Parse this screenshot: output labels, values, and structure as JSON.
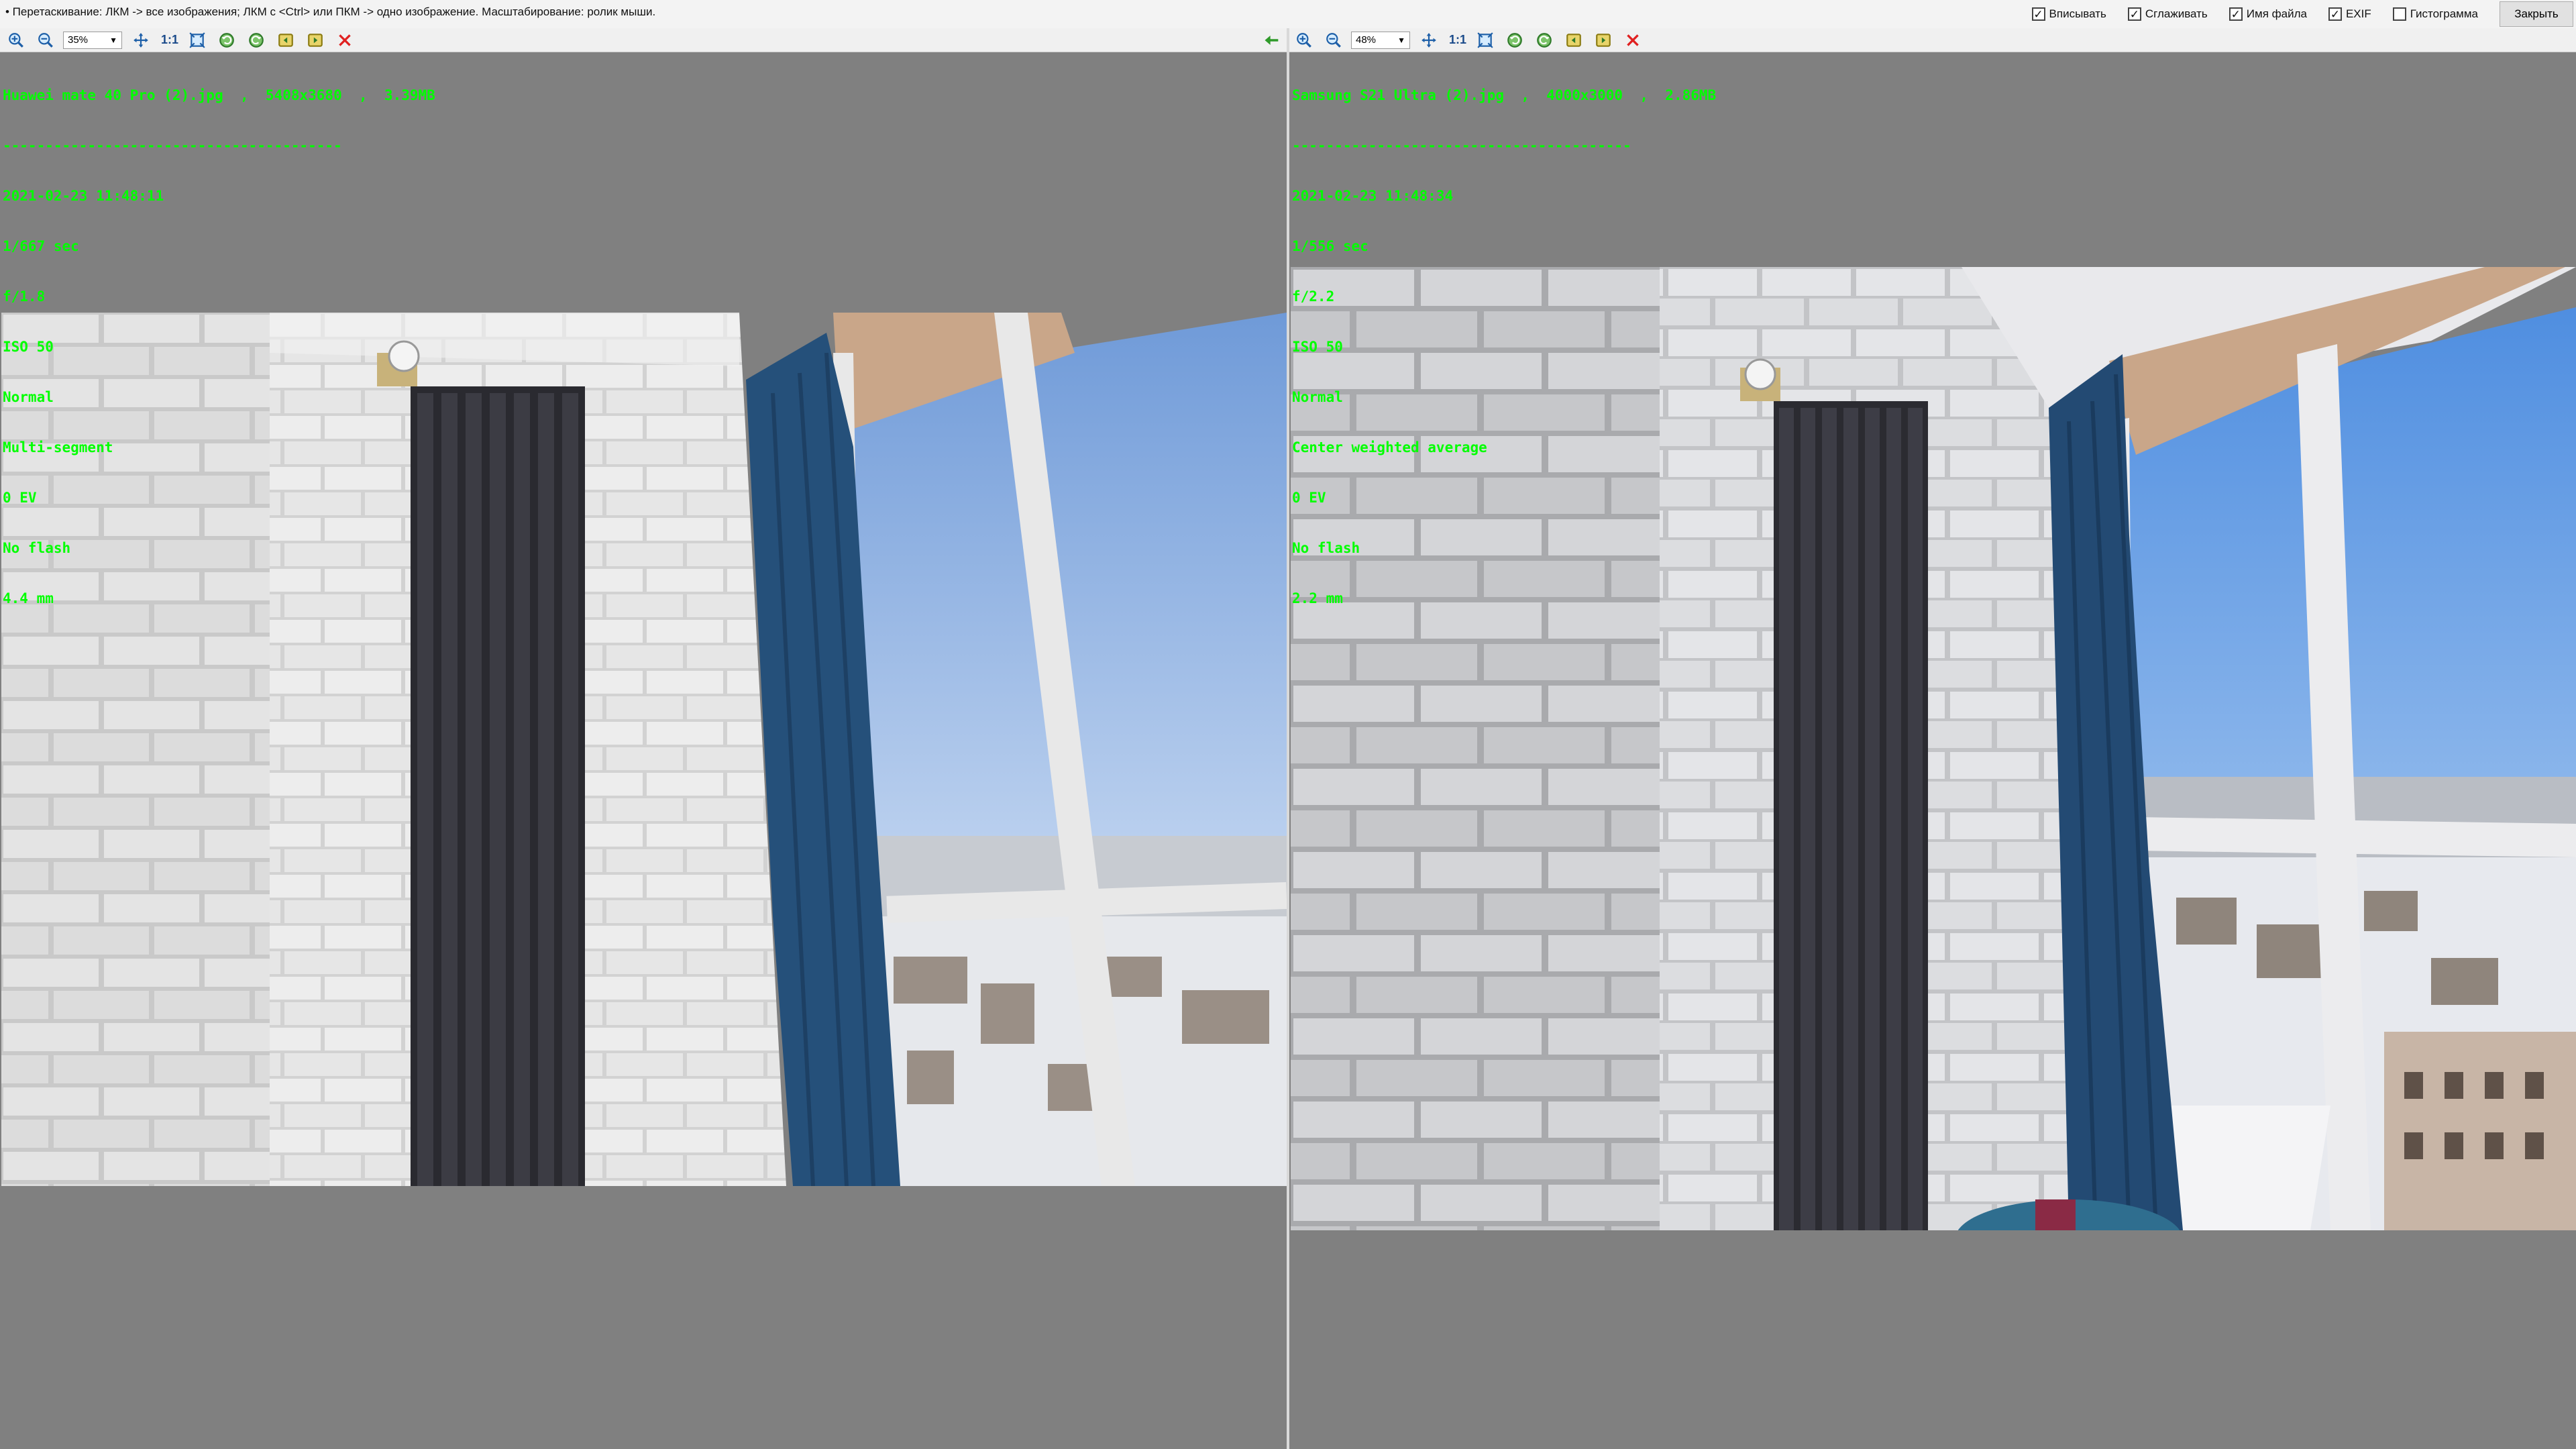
{
  "hint": "• Перетаскивание: ЛКМ -> все изображения; ЛКМ с <Ctrl> или ПКМ -> одно изображение. Масштабирование: ролик мыши.",
  "options": [
    {
      "label": "Вписывать",
      "checked": true
    },
    {
      "label": "Сглаживать",
      "checked": true
    },
    {
      "label": "Имя файла",
      "checked": true
    },
    {
      "label": "EXIF",
      "checked": true
    },
    {
      "label": "Гистограмма",
      "checked": false
    }
  ],
  "close_label": "Закрыть",
  "one_to_one": "1:1",
  "left": {
    "zoom": "35%",
    "file_line": "Huawei mate 40 Pro (2).jpg  ,  5408x3680  ,  3.39MB",
    "separator": "----------------------------------------",
    "exif": [
      "2021-02-23 11:48:11",
      "1/667 sec",
      "f/1.8",
      "ISO 50",
      "Normal",
      "Multi-segment",
      "0 EV",
      "No flash",
      "4.4 mm"
    ]
  },
  "right": {
    "zoom": "48%",
    "file_line": "Samsung S21 Ultra (2).jpg  ,  4000x3000  ,  2.86MB",
    "separator": "----------------------------------------",
    "exif": [
      "2021-02-23 11:48:34",
      "1/556 sec",
      "f/2.2",
      "ISO 50",
      "Normal",
      "Center weighted average",
      "0 EV",
      "No flash",
      "2.2 mm"
    ]
  },
  "colors": {
    "viewer_bg": "#808080",
    "exif_text": "#00ff00"
  }
}
